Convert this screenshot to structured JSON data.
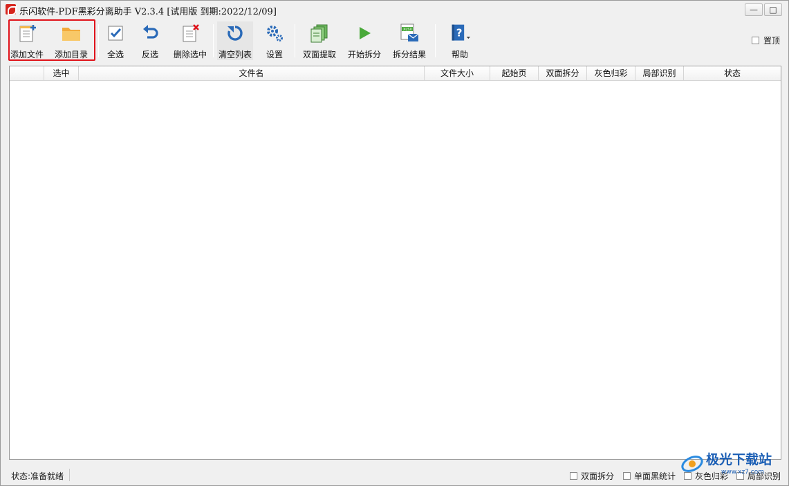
{
  "window": {
    "title": "乐闪软件-PDF黑彩分离助手 V2.3.4 [试用版 到期:2022/12/09]",
    "minimize_symbol": "—",
    "maximize_symbol": "□",
    "close_symbol": "✕"
  },
  "toolbar": {
    "add_file": "添加文件",
    "add_folder": "添加目录",
    "select_all": "全选",
    "invert_select": "反选",
    "delete_selected": "删除选中",
    "clear_list": "清空列表",
    "settings": "设置",
    "duplex_extract": "双面提取",
    "start_split": "开始拆分",
    "split_result": "拆分结果",
    "help": "帮助",
    "pin_on_top": "置顶",
    "pin_checked": false
  },
  "table": {
    "columns": [
      "",
      "选中",
      "文件名",
      "文件大小",
      "起始页",
      "双面拆分",
      "灰色归彩",
      "局部识别",
      "状态"
    ],
    "rows": []
  },
  "statusbar": {
    "status": "状态:准备就绪",
    "options": [
      {
        "label": "双面拆分",
        "checked": false
      },
      {
        "label": "单面黑统计",
        "checked": false
      },
      {
        "label": "灰色归彩",
        "checked": false
      },
      {
        "label": "局部识别",
        "checked": false
      }
    ]
  },
  "watermark": {
    "text": "极光下载站",
    "url_text": "www.xz7.com"
  },
  "colors": {
    "highlight": "#e0121a",
    "accent_blue": "#2a6ab8",
    "folder": "#f6b94a",
    "play_green": "#4aa93a"
  }
}
